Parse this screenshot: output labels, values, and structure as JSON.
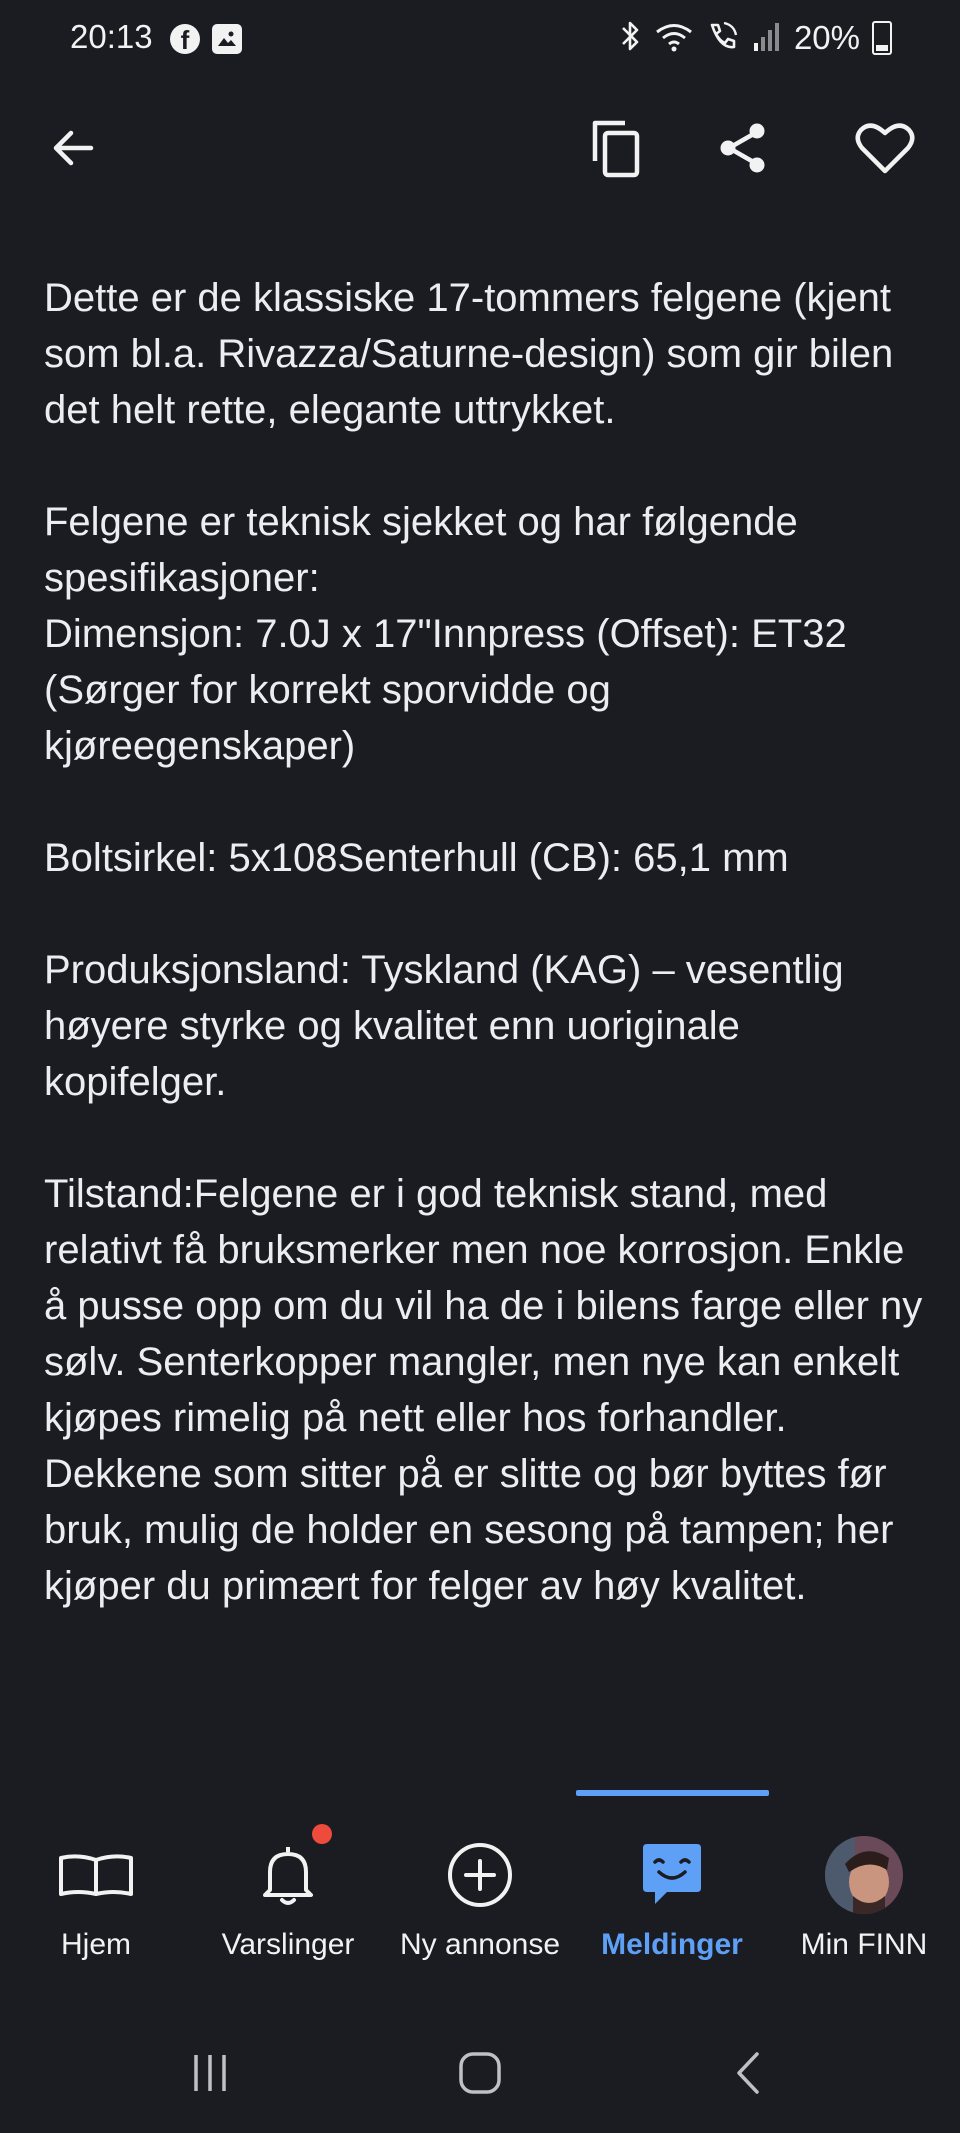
{
  "status_bar": {
    "time": "20:13",
    "facebook_glyph": "f",
    "battery": "20%",
    "icons": [
      "facebook-icon",
      "gallery-icon",
      "bluetooth-icon",
      "wifi-icon",
      "wifi-calling-icon",
      "signal-icon",
      "battery-icon"
    ]
  },
  "top_bar": {
    "icons": [
      "back-arrow-icon",
      "copy-icon",
      "share-icon",
      "heart-icon"
    ]
  },
  "description": {
    "paragraphs": [
      "Dette er de klassiske 17-tommers felgene (kjent som bl.a. Rivazza/Saturne-design) som gir bilen det helt rette, elegante uttrykket.",
      "Felgene er teknisk sjekket og har følgende spesifikasjoner:\nDimensjon: 7.0J x 17\"Innpress (Offset): ET32 (Sørger for korrekt sporvidde og kjøreegenskaper)",
      "Boltsirkel: 5x108Senterhull (CB): 65,1 mm",
      "Produksjonsland: Tyskland (KAG) – vesentlig høyere styrke og kvalitet enn uoriginale kopifelger.",
      "Tilstand:Felgene er i god teknisk stand, med relativt få bruksmerker men noe korrosjon. Enkle å pusse opp om du vil ha de i bilens farge eller ny sølv. Senterkopper mangler, men nye kan enkelt kjøpes rimelig på nett eller hos forhandler. Dekkene som sitter på er slitte og bør byttes før bruk, mulig de holder en sesong på tampen; her kjøper du primært for felger av høy kvalitet."
    ]
  },
  "bottom_nav": {
    "items": [
      {
        "label": "Hjem",
        "icon": "book-icon"
      },
      {
        "label": "Varslinger",
        "icon": "bell-icon"
      },
      {
        "label": "Ny annonse",
        "icon": "plus-circle-icon"
      },
      {
        "label": "Meldinger",
        "icon": "chat-smile-icon"
      },
      {
        "label": "Min FINN",
        "icon": "avatar"
      }
    ],
    "active": "Meldinger",
    "active_color": "#5ea0f6",
    "notification_dot_color": "#ee4b3d"
  },
  "system_nav": {
    "icons": [
      "recent-apps-icon",
      "home-icon",
      "back-icon"
    ]
  },
  "colors": {
    "background": "#1b1c22",
    "text": "#ecedf0"
  }
}
